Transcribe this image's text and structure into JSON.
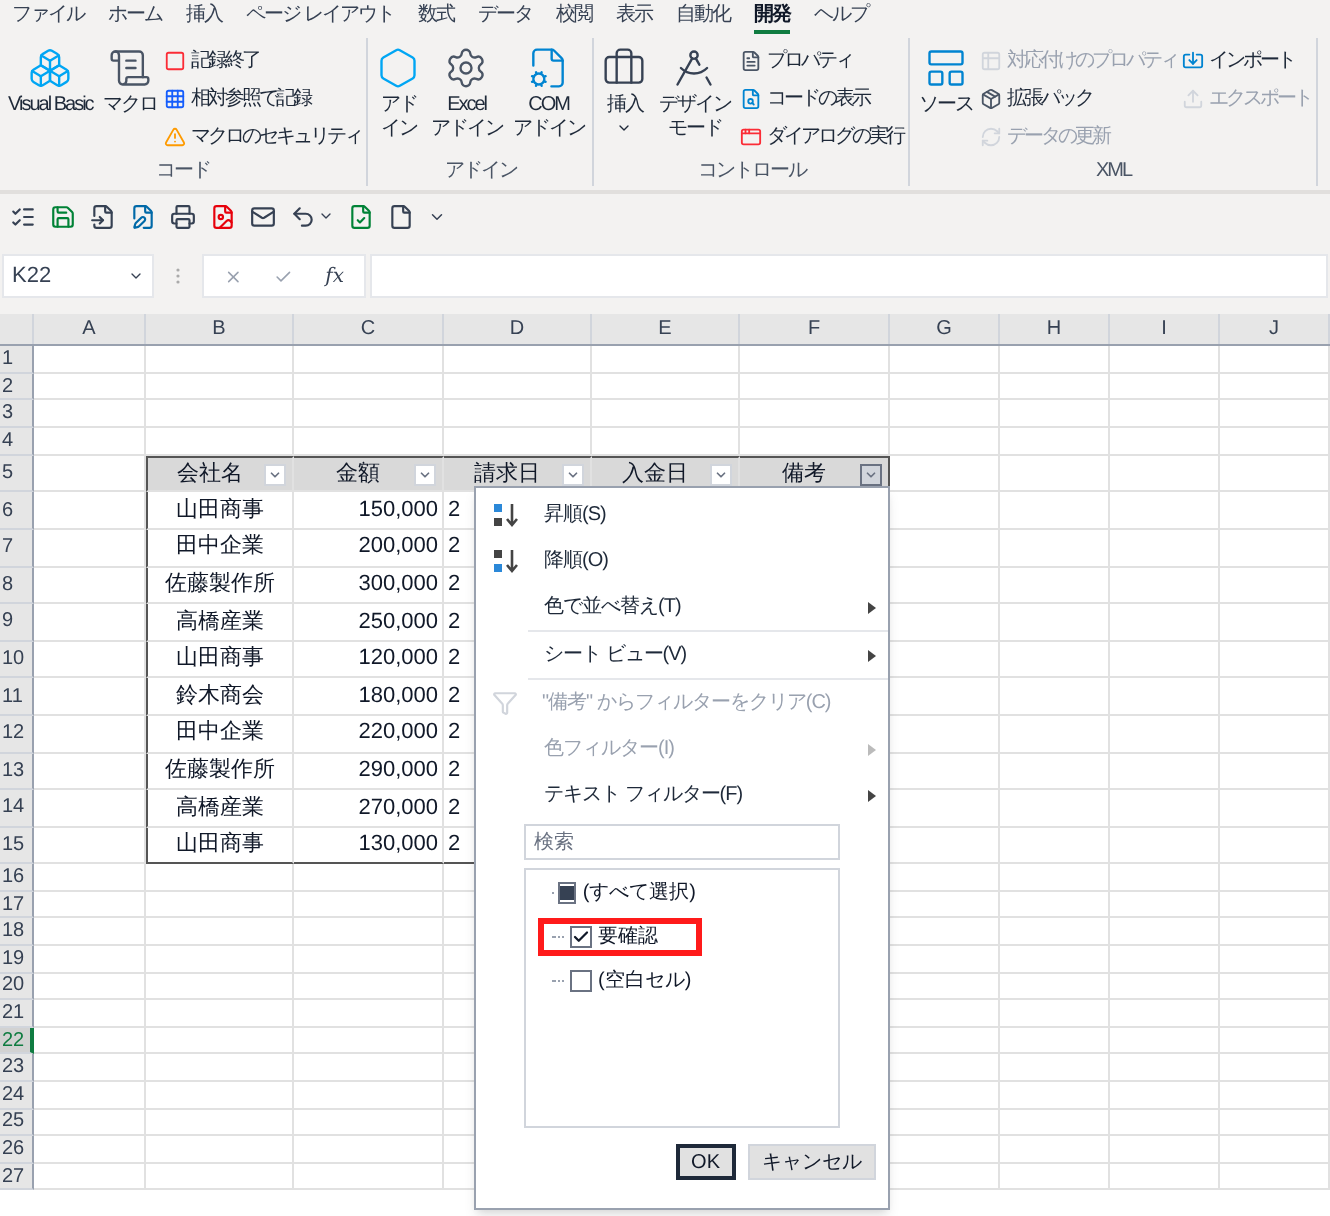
{
  "menu_tabs": [
    {
      "label": "ファイル",
      "selected": false
    },
    {
      "label": "ホーム",
      "selected": false
    },
    {
      "label": "挿入",
      "selected": false
    },
    {
      "label": "ページ レイアウト",
      "selected": false
    },
    {
      "label": "数式",
      "selected": false
    },
    {
      "label": "データ",
      "selected": false
    },
    {
      "label": "校閲",
      "selected": false
    },
    {
      "label": "表示",
      "selected": false
    },
    {
      "label": "自動化",
      "selected": false
    },
    {
      "label": "開発",
      "selected": true
    },
    {
      "label": "ヘルプ",
      "selected": false
    }
  ],
  "ribbon_groups": [
    {
      "label": "コード",
      "items": [
        {
          "kind": "large",
          "label": "Visual Basic",
          "disabled": false
        },
        {
          "kind": "large",
          "label": "マクロ",
          "disabled": false
        },
        {
          "kind": "small",
          "label": "記録終了",
          "disabled": false
        },
        {
          "kind": "small",
          "label": "相対参照で記録",
          "disabled": false
        },
        {
          "kind": "small",
          "label": "マクロのセキュリティ",
          "disabled": false
        }
      ]
    },
    {
      "label": "アドイン",
      "items": [
        {
          "kind": "large",
          "label": "アドイン",
          "disabled": false
        },
        {
          "kind": "large",
          "label": "Excel\nアドイン",
          "disabled": false
        },
        {
          "kind": "large",
          "label": "COM\nアドイン",
          "disabled": false
        }
      ]
    },
    {
      "label": "コントロール",
      "items": [
        {
          "kind": "dropdown",
          "label": "挿入",
          "disabled": false
        },
        {
          "kind": "large",
          "label": "デザインモード",
          "disabled": false
        },
        {
          "kind": "small",
          "label": "プロパティ",
          "disabled": false
        },
        {
          "kind": "small",
          "label": "コードの表示",
          "disabled": false
        },
        {
          "kind": "small",
          "label": "ダイアログの実行",
          "disabled": false
        }
      ]
    },
    {
      "label": "XML",
      "items": [
        {
          "kind": "large",
          "label": "ソース",
          "disabled": false
        },
        {
          "kind": "small",
          "label": "対応付けのプロパティ",
          "disabled": true
        },
        {
          "kind": "small",
          "label": "拡張パック",
          "disabled": false
        },
        {
          "kind": "small",
          "label": "データの更新",
          "disabled": true
        },
        {
          "kind": "small",
          "label": "インポート",
          "disabled": false
        },
        {
          "kind": "small",
          "label": "エクスポート",
          "disabled": true
        }
      ]
    }
  ],
  "name_box": {
    "value": "K22"
  },
  "formula_bar": {
    "function_label": "fx"
  },
  "columns": [
    "A",
    "B",
    "C",
    "D",
    "E",
    "F",
    "G",
    "H",
    "I",
    "J"
  ],
  "rows": [
    {
      "label": "1",
      "selected": false
    },
    {
      "label": "2",
      "selected": false
    },
    {
      "label": "3",
      "selected": false
    },
    {
      "label": "4",
      "selected": false
    },
    {
      "label": "5",
      "selected": false
    },
    {
      "label": "6",
      "selected": false
    },
    {
      "label": "7",
      "selected": false
    },
    {
      "label": "8",
      "selected": false
    },
    {
      "label": "9",
      "selected": false
    },
    {
      "label": "10",
      "selected": false
    },
    {
      "label": "11",
      "selected": false
    },
    {
      "label": "12",
      "selected": false
    },
    {
      "label": "13",
      "selected": false
    },
    {
      "label": "14",
      "selected": false
    },
    {
      "label": "15",
      "selected": false
    },
    {
      "label": "16",
      "selected": false
    },
    {
      "label": "17",
      "selected": false
    },
    {
      "label": "18",
      "selected": false
    },
    {
      "label": "19",
      "selected": false
    },
    {
      "label": "20",
      "selected": false
    },
    {
      "label": "21",
      "selected": false
    },
    {
      "label": "22",
      "selected": true
    },
    {
      "label": "23",
      "selected": false
    },
    {
      "label": "24",
      "selected": false
    },
    {
      "label": "25",
      "selected": false
    },
    {
      "label": "26",
      "selected": false
    },
    {
      "label": "27",
      "selected": false
    }
  ],
  "table": {
    "headers": [
      {
        "label": "会社名",
        "open": false
      },
      {
        "label": "金額",
        "open": false
      },
      {
        "label": "請求日",
        "open": false
      },
      {
        "label": "入金日",
        "open": false
      },
      {
        "label": "備考",
        "open": true
      }
    ],
    "rows": [
      {
        "company": "山田商事",
        "amount": "150,000",
        "billing_date": "2"
      },
      {
        "company": "田中企業",
        "amount": "200,000",
        "billing_date": "2"
      },
      {
        "company": "佐藤製作所",
        "amount": "300,000",
        "billing_date": "2"
      },
      {
        "company": "高橋産業",
        "amount": "250,000",
        "billing_date": "2"
      },
      {
        "company": "山田商事",
        "amount": "120,000",
        "billing_date": "2"
      },
      {
        "company": "鈴木商会",
        "amount": "180,000",
        "billing_date": "2"
      },
      {
        "company": "田中企業",
        "amount": "220,000",
        "billing_date": "2"
      },
      {
        "company": "佐藤製作所",
        "amount": "290,000",
        "billing_date": "2"
      },
      {
        "company": "高橋産業",
        "amount": "270,000",
        "billing_date": "2"
      },
      {
        "company": "山田商事",
        "amount": "130,000",
        "billing_date": "2"
      }
    ]
  },
  "filter_menu": {
    "sections": [
      [
        {
          "kind": "sort_ascending",
          "label": "昇順(S)",
          "disabled": false,
          "submenu": false
        },
        {
          "kind": "sort_descending",
          "label": "降順(O)",
          "disabled": false,
          "submenu": false
        },
        {
          "kind": "plain",
          "label": "色で並べ替え(T)",
          "disabled": false,
          "submenu": true
        }
      ],
      [
        {
          "kind": "plain",
          "label": "シート ビュー(V)",
          "disabled": false,
          "submenu": true
        }
      ],
      [
        {
          "kind": "clear_filter",
          "label": "\"備考\" からフィルターをクリア(C)",
          "disabled": true,
          "submenu": false
        },
        {
          "kind": "plain",
          "label": "色フィルター(I)",
          "disabled": true,
          "submenu": true
        },
        {
          "kind": "plain",
          "label": "テキスト フィルター(F)",
          "disabled": false,
          "submenu": true
        }
      ]
    ],
    "search": {
      "placeholder": "検索"
    },
    "values": [
      {
        "label": "(すべて選択)",
        "checked": false,
        "indeterminate": true,
        "highlighted": false
      },
      {
        "label": "要確認",
        "checked": true,
        "indeterminate": false,
        "highlighted": true
      },
      {
        "label": "(空白セル)",
        "checked": false,
        "indeterminate": false,
        "highlighted": false
      }
    ],
    "buttons": [
      {
        "label": "OK",
        "default": true
      },
      {
        "label": "キャンセル",
        "default": false
      }
    ]
  }
}
